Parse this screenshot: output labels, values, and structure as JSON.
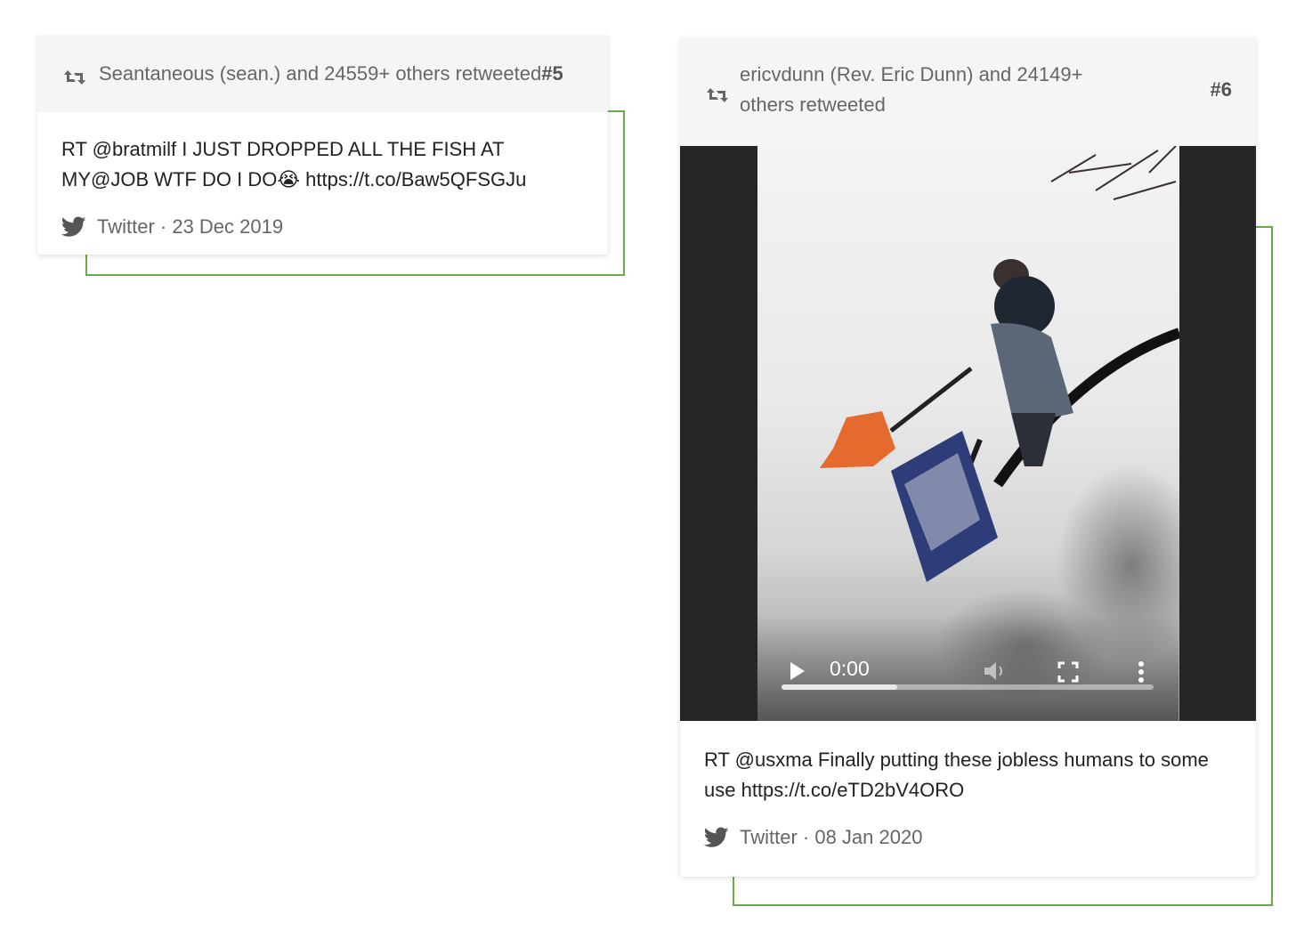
{
  "tweets": [
    {
      "retweet_text": "Seantaneous (sean.) and 24559+ others retweeted",
      "rank": "#5",
      "body": "RT @bratmilf I JUST DROPPED ALL THE FISH AT MY@JOB WTF DO I DO😭 https://t.co/Baw5QFSGJu",
      "source": "Twitter · 23 Dec 2019"
    },
    {
      "retweet_text": "ericvdunn (Rev. Eric Dunn) and 24149+ others retweeted",
      "rank": "#6",
      "body": "RT @usxma Finally putting these jobless humans to some use https://t.co/eTD2bV4ORO",
      "source": "Twitter · 08 Jan 2020",
      "video": {
        "time": "0:00",
        "progress": 0.31
      }
    }
  ],
  "icons": {
    "retweet": "retweet-icon",
    "twitter": "twitter-bird-icon",
    "play": "play-icon",
    "volume": "volume-icon",
    "fullscreen": "fullscreen-icon",
    "more": "more-options-icon"
  },
  "colors": {
    "accent_frame": "#6aaa47",
    "header_bg": "#f5f5f5",
    "video_bg": "#262626"
  }
}
